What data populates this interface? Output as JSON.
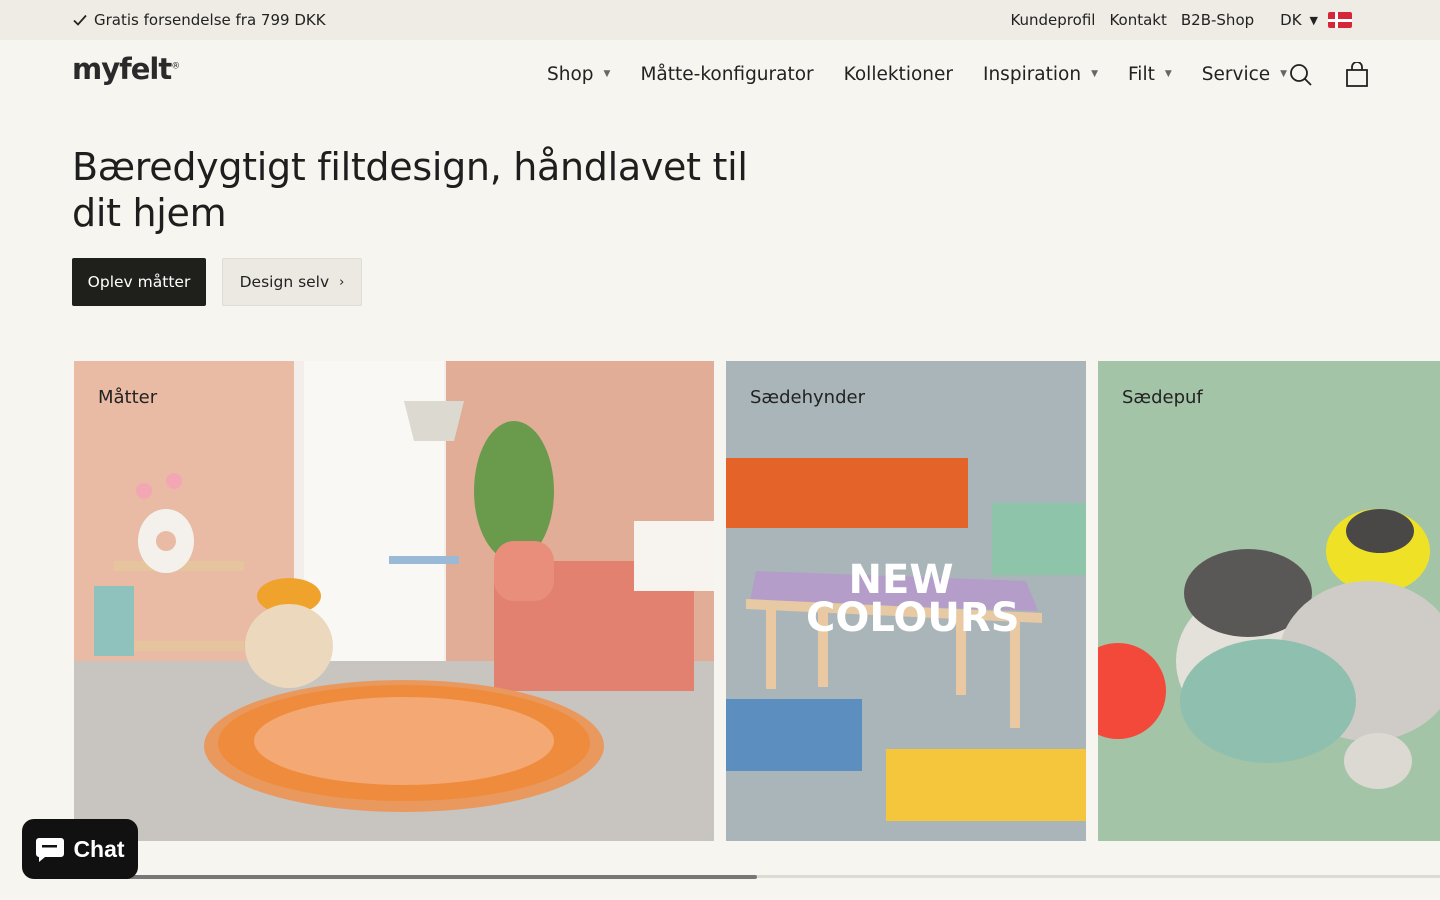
{
  "topbar": {
    "promo": "Gratis forsendelse fra 799 DKK",
    "links": [
      "Kundeprofil",
      "Kontakt",
      "B2B-Shop"
    ],
    "language": "DK"
  },
  "header": {
    "logo": "myfelt",
    "logo_mark": "®",
    "nav": [
      {
        "label": "Shop",
        "dropdown": true
      },
      {
        "label": "Måtte-konfigurator",
        "dropdown": false
      },
      {
        "label": "Kollektioner",
        "dropdown": false
      },
      {
        "label": "Inspiration",
        "dropdown": true
      },
      {
        "label": "Filt",
        "dropdown": true
      },
      {
        "label": "Service",
        "dropdown": true
      }
    ]
  },
  "hero": {
    "headline": "Bæredygtigt filtdesign, håndlavet til dit hjem",
    "primary_button": "Oplev måtter",
    "secondary_button": "Design selv",
    "secondary_chevron": "›"
  },
  "cards": [
    {
      "label": "Måtter",
      "bg": "#e9bba4"
    },
    {
      "label": "Sædehynder",
      "bg": "#a9b5b9",
      "overlay_line1": "NEW",
      "overlay_line2": "COLOURS"
    },
    {
      "label": "Sædepuf",
      "bg": "#a4c4a8"
    }
  ],
  "carousel": {
    "progress": 0.5
  },
  "chat": {
    "label": "Chat"
  }
}
